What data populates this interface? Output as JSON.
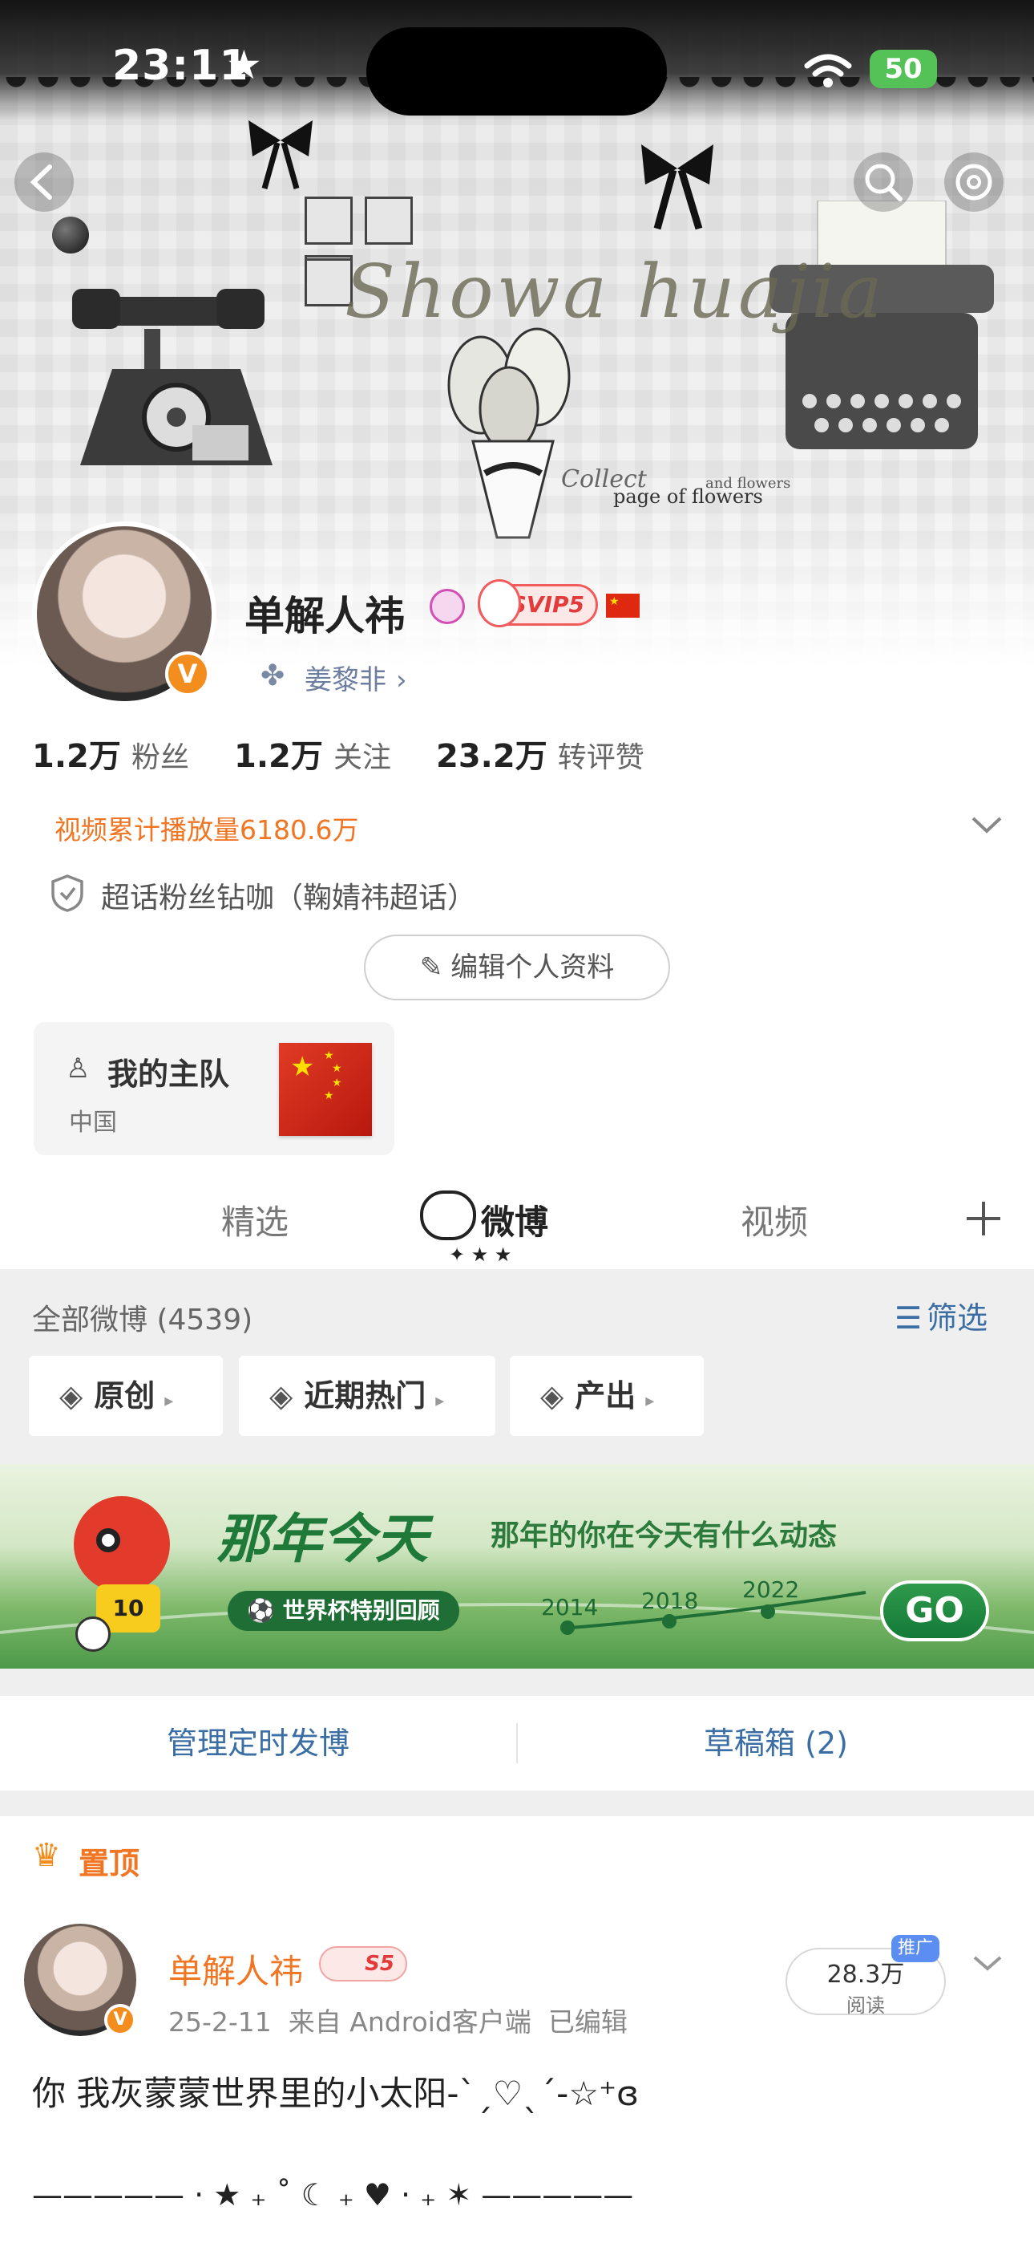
{
  "status_bar": {
    "time": "23:11",
    "battery": "50"
  },
  "banner": {
    "title_script": "Showa huajia",
    "caption_1": "page of flowers",
    "caption_2": "Collect",
    "caption_3": "and flowers"
  },
  "profile": {
    "name": "单解人祎",
    "vip_label": "SVIP5",
    "linked_name": "姜黎非",
    "verified_badge": "V",
    "stats": [
      {
        "value": "1.2万",
        "label": "粉丝"
      },
      {
        "value": "1.2万",
        "label": "关注"
      },
      {
        "value": "23.2万",
        "label": "转评赞"
      }
    ],
    "video_stats": "视频累计播放量6180.6万",
    "supertopic": "超话粉丝钻咖（鞠婧祎超话）",
    "edit_label": "编辑个人资料",
    "team": {
      "title": "我的主队",
      "country": "中国"
    }
  },
  "tabs": [
    {
      "label": "精选"
    },
    {
      "label": "微博"
    },
    {
      "label": "视频"
    }
  ],
  "feed_header": {
    "all_posts": "全部微博 (4539)",
    "filter_label": "筛选",
    "chips": [
      {
        "label": "原创"
      },
      {
        "label": "近期热门"
      },
      {
        "label": "产出"
      }
    ]
  },
  "promo": {
    "title": "那年今天",
    "subtitle": "那年的你在今天有什么动态",
    "tag": "世界杯特别回顾",
    "years": [
      "2014",
      "2018",
      "2022"
    ],
    "player_number": "10",
    "go_label": "GO"
  },
  "actions": {
    "schedule": "管理定时发博",
    "drafts": "草稿箱 (2)"
  },
  "pinned": {
    "label": "置顶"
  },
  "post": {
    "author": "单解人祎",
    "level_badge": "S5",
    "meta": "25-2-11  来自 Android客户端  已编辑",
    "reads_value": "28.3万",
    "reads_label": "阅读",
    "promo_tag": "推广",
    "text": "你 我灰蒙蒙世界里的小太阳-ˋˏ♡ˎˊ-☆⁺ɞ",
    "divider": "————— · ★ ₊ ˚ ☾ ₊ ♥ · ₊ ✶ —————"
  },
  "colors": {
    "accent_orange": "#f07623",
    "link_blue": "#3a6ea5",
    "vip_red": "#e23b3b"
  }
}
